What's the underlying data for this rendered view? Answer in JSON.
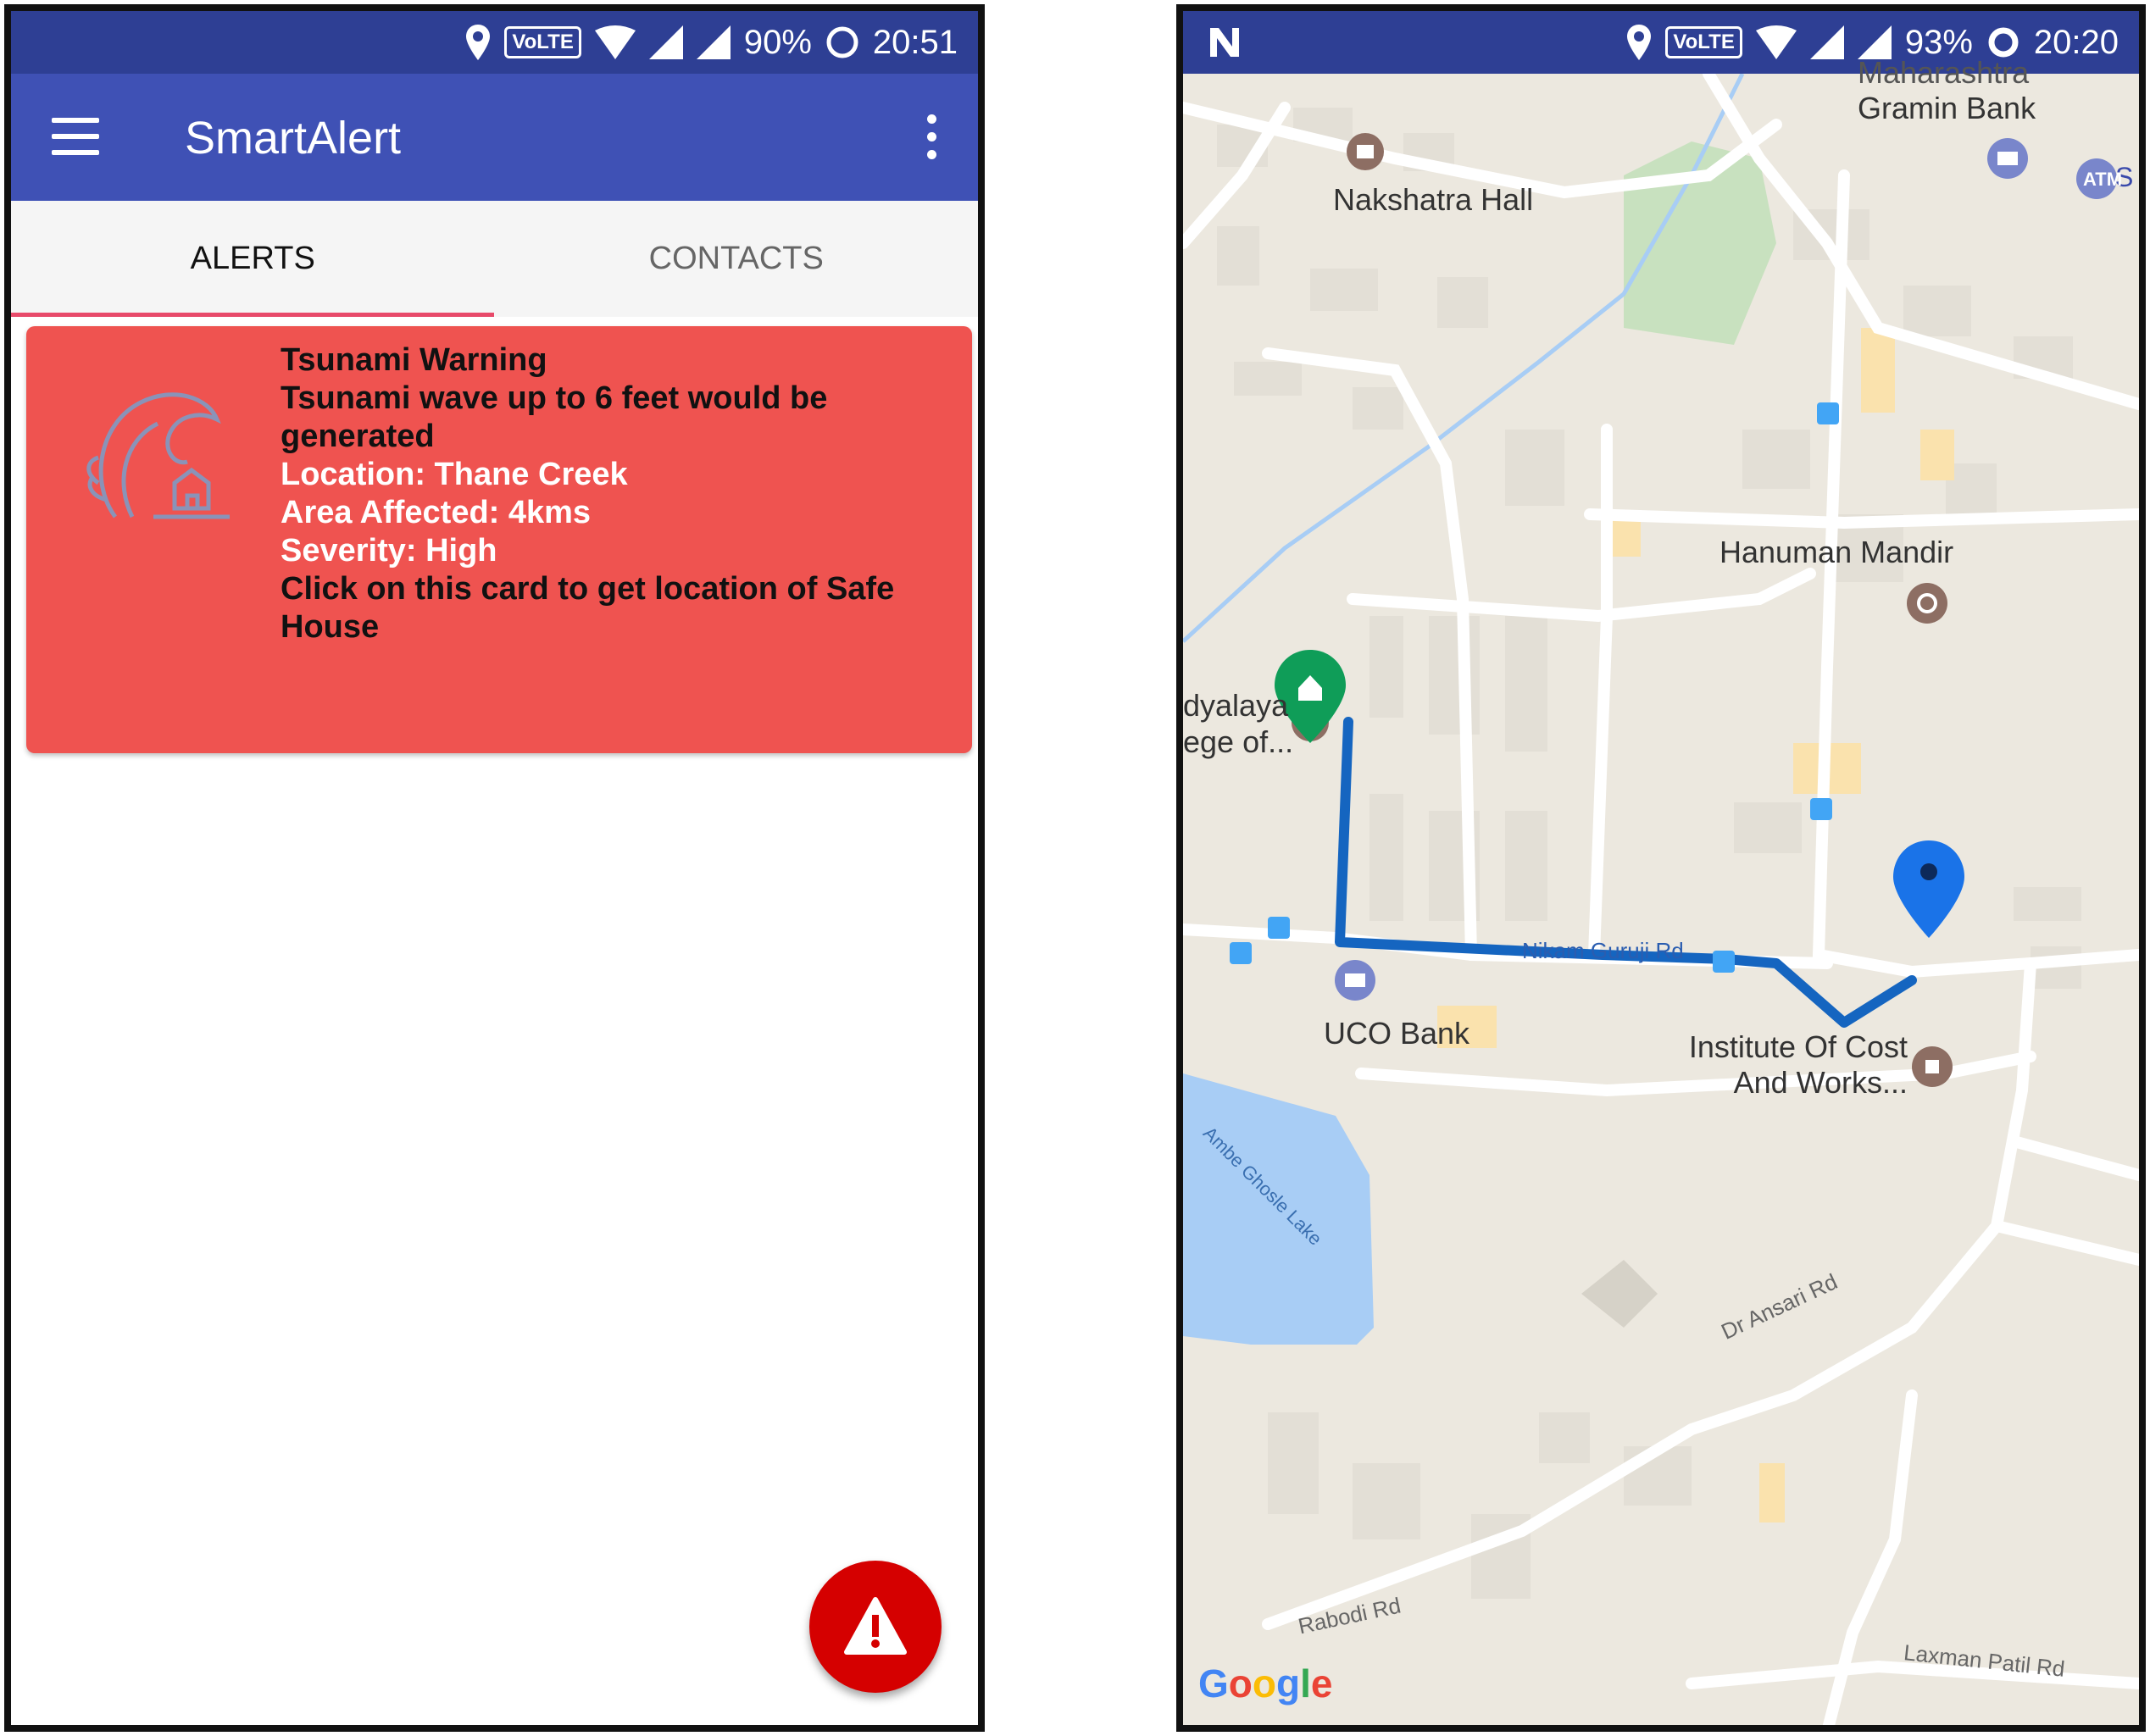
{
  "left_screen": {
    "status_bar": {
      "volte": "VoLTE",
      "battery": "90%",
      "time": "20:51"
    },
    "app_bar": {
      "title": "SmartAlert"
    },
    "tabs": [
      {
        "label": "ALERTS",
        "active": true
      },
      {
        "label": "CONTACTS",
        "active": false
      }
    ],
    "alert_card": {
      "title": "Tsunami Warning",
      "description": "Tsunami wave up to 6 feet would be generated",
      "location": "Location: Thane Creek",
      "area": "Area Affected: 4kms",
      "severity": "Severity: High",
      "instruction": "Click on this card to get location of Safe House",
      "icon": "tsunami-wave-icon"
    },
    "fab": {
      "icon": "warning-icon"
    },
    "colors": {
      "app_bar": "#3f51b5",
      "status_bar": "#2e3f94",
      "card": "#ef5350",
      "tab_indicator": "#e84a6a",
      "fab": "#d50000"
    }
  },
  "right_screen": {
    "status_bar": {
      "volte": "VoLTE",
      "battery": "93%",
      "time": "20:20"
    },
    "map": {
      "places": {
        "top_partial": "Maharashtra",
        "gramin_bank": "Gramin Bank",
        "nakshatra_hall": "Nakshatra Hall",
        "hanuman_mandir": "Hanuman Mandir",
        "vidyalaya": "dyalaya",
        "college": "ege of...",
        "uco_bank": "UCO Bank",
        "institute_line1": "Institute Of Cost",
        "institute_line2": "And Works...",
        "atm": "ATM",
        "atm_side": "S"
      },
      "roads": {
        "nikam_guruji": "Nikam Guruji Rd",
        "dr_ansari": "Dr Ansari Rd",
        "rabodi": "Rabodi Rd",
        "laxman_patil": "Laxman Patil Rd",
        "lake": "Ambe Ghosle Lake"
      },
      "brand": {
        "g1": "G",
        "o1": "o",
        "o2": "o",
        "g2": "g",
        "l": "l",
        "e": "e"
      },
      "colors": {
        "route": "#1565c0",
        "safe_house_marker": "#0f9d58",
        "user_marker": "#1a73e8",
        "water": "#a8cdf5",
        "park": "#c8e1bf"
      }
    }
  }
}
